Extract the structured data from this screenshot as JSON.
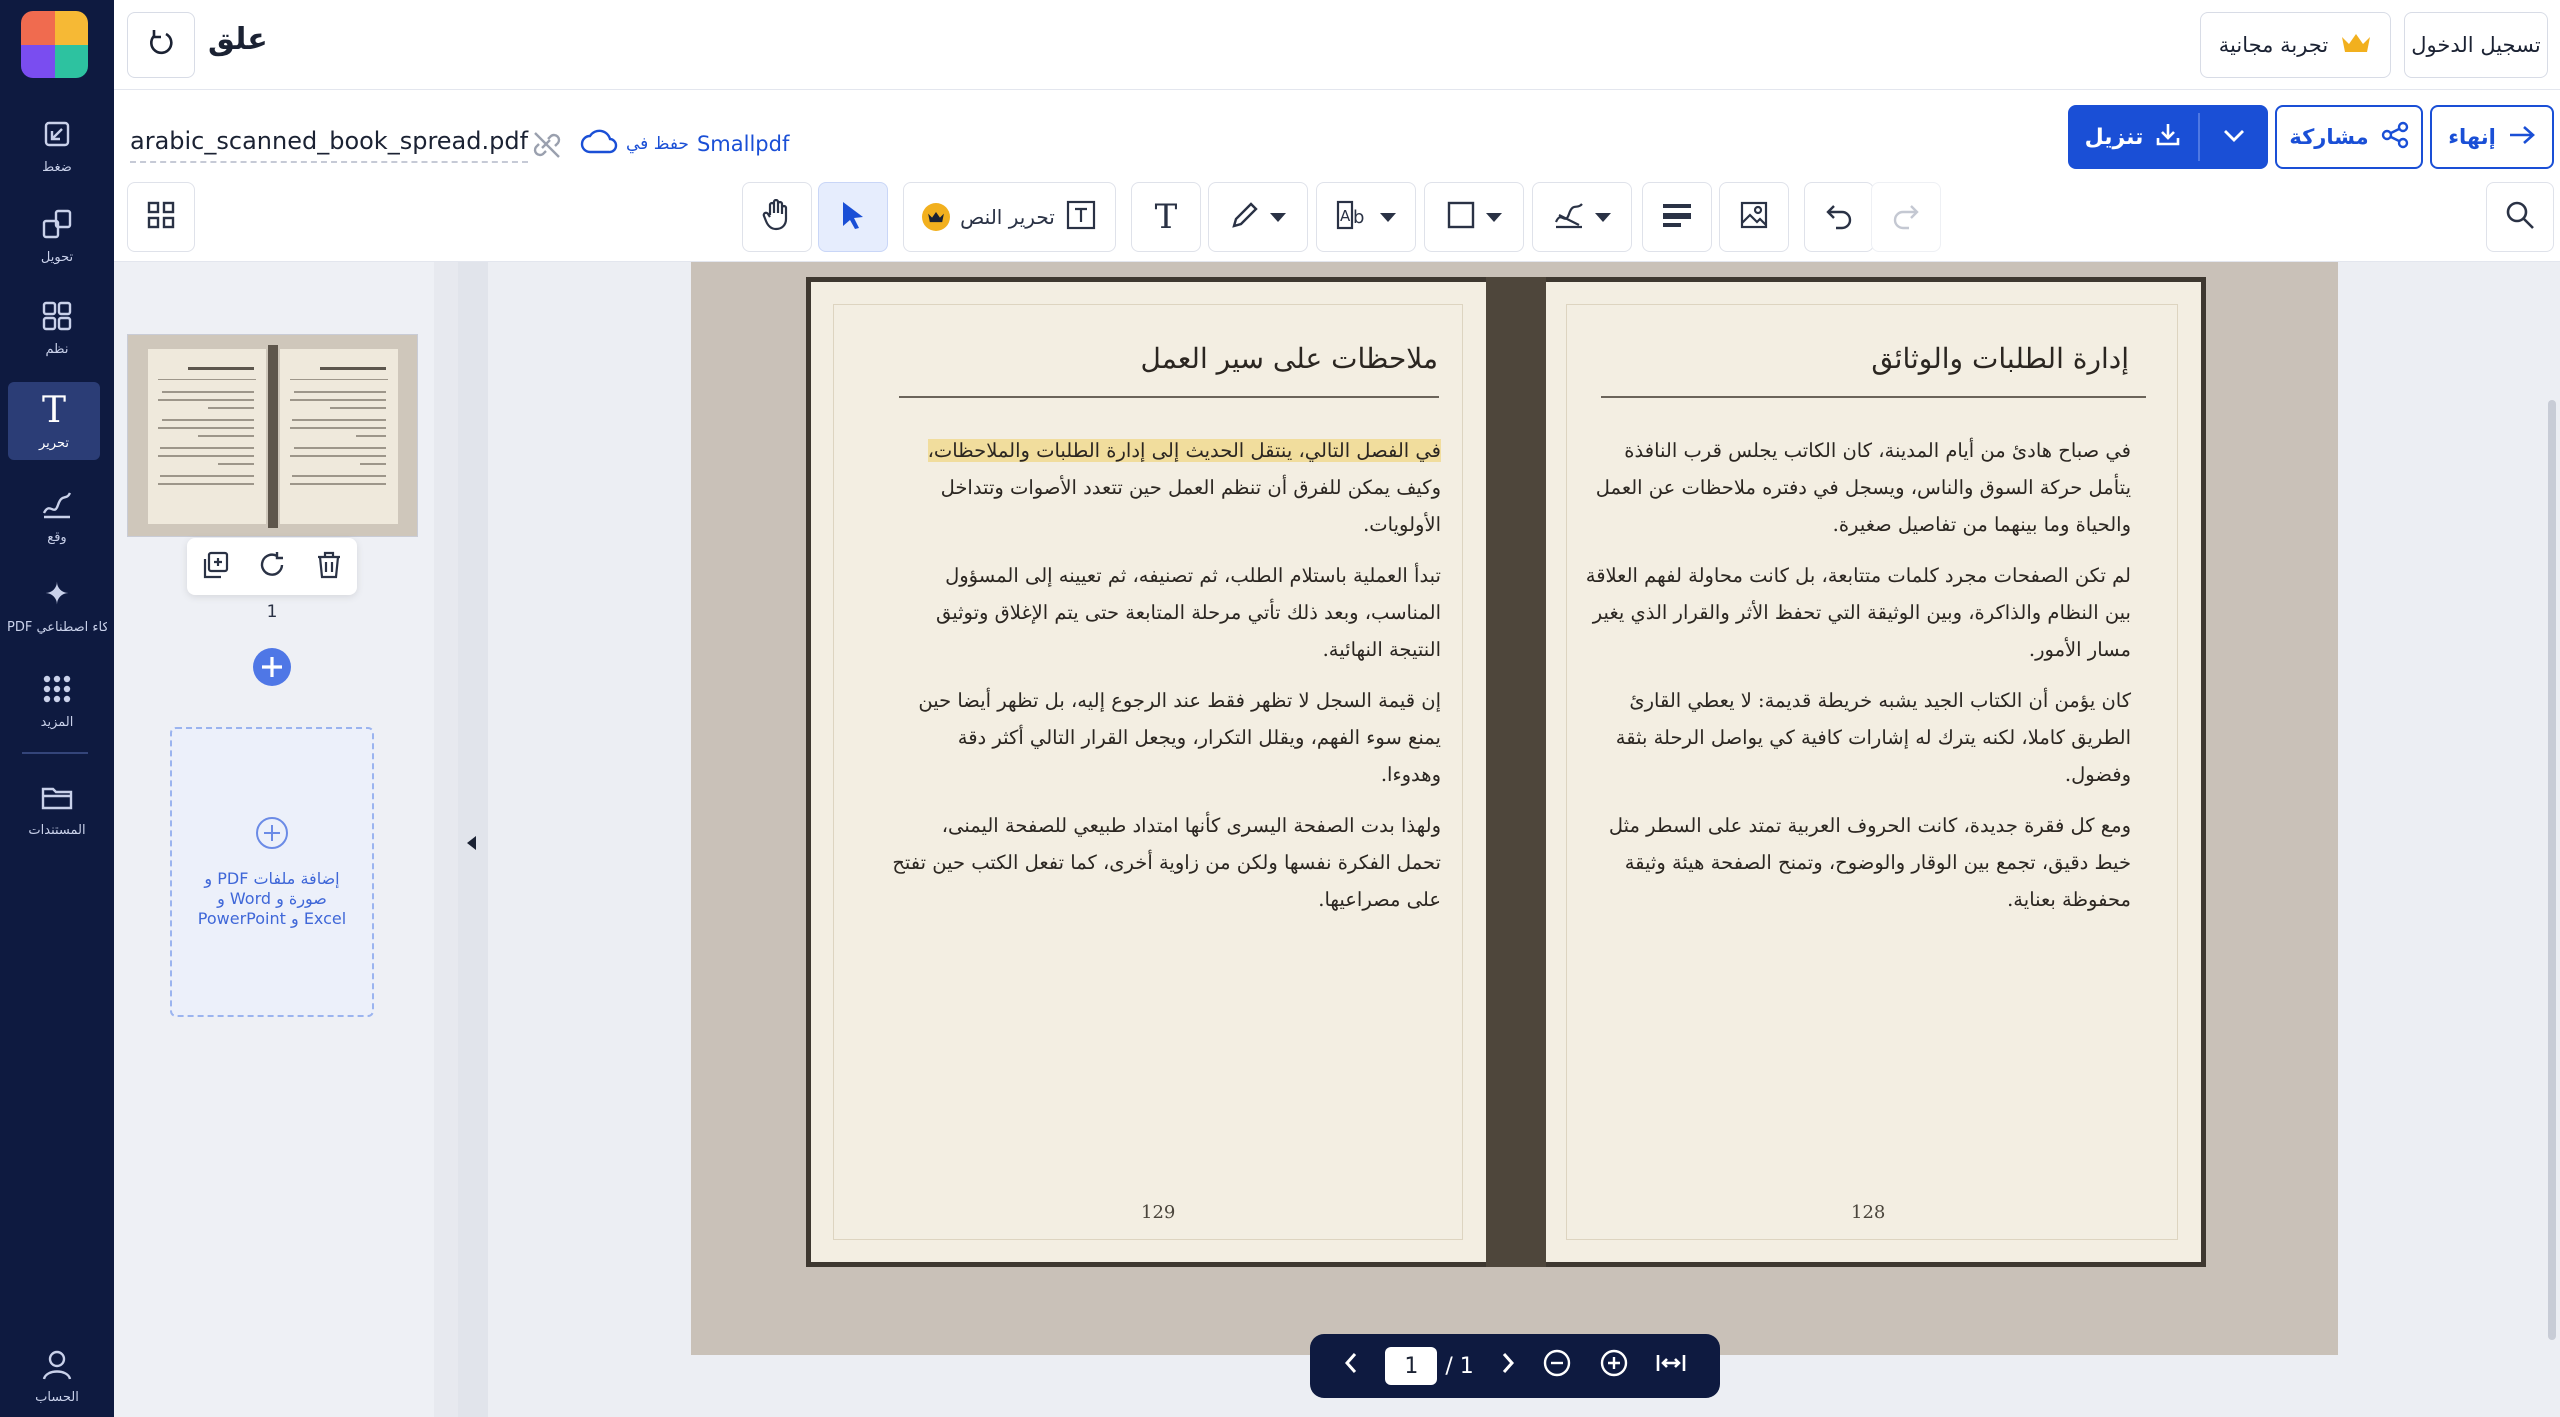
{
  "app": {
    "title": "علق"
  },
  "rail": {
    "items": [
      {
        "label": "ضغط",
        "icon": "compress-icon"
      },
      {
        "label": "تحويل",
        "icon": "convert-icon"
      },
      {
        "label": "نظم",
        "icon": "organize-icon"
      },
      {
        "label": "تحرير",
        "icon": "edit-text-icon"
      },
      {
        "label": "وقع",
        "icon": "sign-icon"
      },
      {
        "label": "PDF ذكاء اصطناعي...",
        "icon": "ai-sparkle-icon"
      },
      {
        "label": "المزيد",
        "icon": "more-grid-icon"
      },
      {
        "label": "المستندات",
        "icon": "folder-icon"
      },
      {
        "label": "الحساب",
        "icon": "account-icon"
      }
    ],
    "active": "تحرير"
  },
  "topbar": {
    "login_label": "تسجيل الدخول",
    "trial_label": "تجربة مجانية"
  },
  "file": {
    "name": "arabic_scanned_book_spread.pdf",
    "save_label": "حفظ في",
    "save_target": "Smallpdf"
  },
  "actions": {
    "finish_label": "إنهاء",
    "share_label": "مشاركة",
    "download_label": "تنزيل"
  },
  "toolbar": {
    "edit_text_label": "تحرير النص"
  },
  "sidebar": {
    "page_label": "1",
    "add_files_text": "إضافة ملفات PDF و صورة و Word و Excel و PowerPoint"
  },
  "book": {
    "left_page": {
      "title": "ملاحظات على سير العمل",
      "paragraphs": [
        [
          "في الفصل التالي، ينتقل الحديث إلى إدارة الطلبات والملاحظات،",
          "وكيف يمكن للفرق أن تنظم العمل حين تتعدد الأصوات وتتداخل",
          "الأولويات."
        ],
        [
          "تبدأ العملية باستلام الطلب، ثم تصنيفه، ثم تعيينه إلى المسؤول",
          "المناسب، وبعد ذلك تأتي مرحلة المتابعة حتى يتم الإغلاق وتوثيق",
          "النتيجة النهائية."
        ],
        [
          "إن قيمة السجل لا تظهر فقط عند الرجوع إليه، بل تظهر أيضا حين",
          "يمنع سوء الفهم، ويقلل التكرار، ويجعل القرار التالي أكثر دقة",
          "وهدوءا."
        ],
        [
          "ولهذا بدت الصفحة اليسرى كأنها امتداد طبيعي للصفحة اليمنى،",
          "تحمل الفكرة نفسها ولكن من زاوية أخرى، كما تفعل الكتب حين تفتح",
          "على مصراعيها."
        ]
      ],
      "page_number": "129"
    },
    "right_page": {
      "title": "إدارة الطلبات والوثائق",
      "paragraphs": [
        [
          "في صباح هادئ من أيام المدينة، كان الكاتب يجلس قرب النافذة",
          "يتأمل حركة السوق والناس، ويسجل في دفتره ملاحظات عن العمل",
          "والحياة وما بينهما من تفاصيل صغيرة."
        ],
        [
          "لم تكن الصفحات مجرد كلمات متتابعة، بل كانت محاولة لفهم العلاقة",
          "بين النظام والذاكرة، وبين الوثيقة التي تحفظ الأثر والقرار الذي يغير",
          "مسار الأمور."
        ],
        [
          "كان يؤمن أن الكتاب الجيد يشبه خريطة قديمة: لا يعطي القارئ",
          "الطريق كاملا، لكنه يترك له إشارات كافية كي يواصل الرحلة بثقة",
          "وفضول."
        ],
        [
          "ومع كل فقرة جديدة، كانت الحروف العربية تمتد على السطر مثل",
          "خيط دقيق، تجمع بين الوقار والوضوح، وتمنح الصفحة هيئة وثيقة",
          "محفوظة بعناية."
        ]
      ],
      "page_number": "128"
    }
  },
  "pagenav": {
    "current": "1",
    "total": "/ 1"
  },
  "colors": {
    "rail_bg": "#0e1a40",
    "accent": "#1a4fd6",
    "paper": "#f3eee2",
    "highlight": "#f1dd9d"
  }
}
